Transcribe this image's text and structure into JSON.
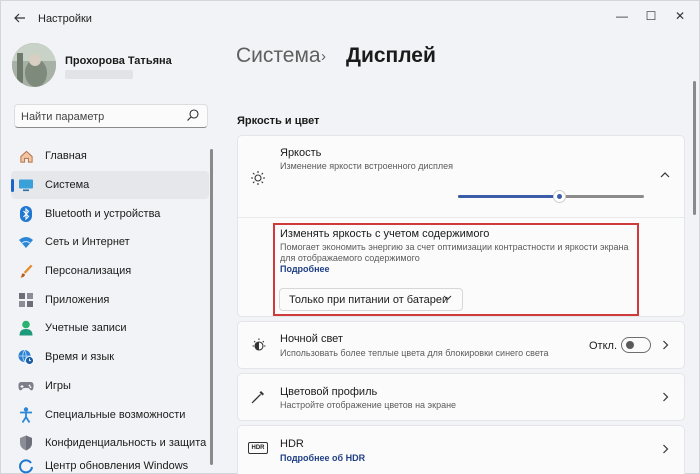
{
  "window": {
    "title": "Настройки",
    "controls": [
      "—",
      "☐",
      "✕"
    ]
  },
  "user": {
    "name": "Прохорова Татьяна"
  },
  "search": {
    "placeholder": "Найти параметр"
  },
  "nav": [
    {
      "label": "Главная",
      "icon": "home-icon",
      "active": false
    },
    {
      "label": "Система",
      "icon": "system-display-icon",
      "active": true
    },
    {
      "label": "Bluetooth и устройства",
      "icon": "bluetooth-icon",
      "active": false
    },
    {
      "label": "Сеть и Интернет",
      "icon": "wifi-icon",
      "active": false
    },
    {
      "label": "Персонализация",
      "icon": "brush-icon",
      "active": false
    },
    {
      "label": "Приложения",
      "icon": "apps-icon",
      "active": false
    },
    {
      "label": "Учетные записи",
      "icon": "accounts-icon",
      "active": false
    },
    {
      "label": "Время и язык",
      "icon": "globe-clock-icon",
      "active": false
    },
    {
      "label": "Игры",
      "icon": "gamepad-icon",
      "active": false
    },
    {
      "label": "Специальные возможности",
      "icon": "accessibility-icon",
      "active": false
    },
    {
      "label": "Конфиденциальность и защита",
      "icon": "shield-icon",
      "active": false
    },
    {
      "label": "Центр обновления Windows",
      "icon": "update-icon",
      "active": false
    }
  ],
  "breadcrumb": {
    "parent": "Система",
    "separator": "›",
    "current": "Дисплей"
  },
  "section_title": "Яркость и цвет",
  "brightness": {
    "title": "Яркость",
    "subtitle": "Изменение яркости встроенного дисплея",
    "level_fraction": 0.55,
    "content_adaptive": {
      "title": "Изменять яркость с учетом содержимого",
      "description": "Помогает экономить энергию за счет оптимизации контрастности и яркости экрана для отображаемого содержимого",
      "link": "Подробнее",
      "dropdown_value": "Только при питании от батареи"
    }
  },
  "night_light": {
    "title": "Ночной свет",
    "subtitle": "Использовать более теплые цвета для блокировки синего света",
    "state_label": "Откл.",
    "on": false
  },
  "color_profile": {
    "title": "Цветовой профиль",
    "subtitle": "Настройте отображение цветов на экране"
  },
  "hdr": {
    "icon_text": "HDR",
    "title": "HDR",
    "link": "Подробнее об HDR"
  },
  "colors": {
    "accent": "#3b5ca8",
    "highlight_box": "#cf3b3b",
    "nav_indicator": "#1b64c8"
  }
}
